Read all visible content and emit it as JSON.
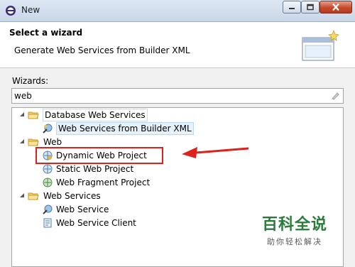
{
  "window": {
    "title": "New"
  },
  "header": {
    "title": "Select a wizard",
    "description": "Generate Web Services from Builder XML"
  },
  "wizards_label": "Wizards:",
  "filter": {
    "value": "web"
  },
  "tree": {
    "database_web_services": {
      "label": "Database Web Services",
      "child": "Web Services from Builder XML"
    },
    "web": {
      "label": "Web",
      "children": [
        "Dynamic Web Project",
        "Static Web Project",
        "Web Fragment Project"
      ]
    },
    "web_services": {
      "label": "Web Services",
      "children": [
        "Web Service",
        "Web Service Client"
      ]
    }
  },
  "watermark": {
    "big": "百科全说",
    "small": "助你轻松解决"
  },
  "colors": {
    "highlight": "#e0201b",
    "selection": "#cce8ff"
  }
}
